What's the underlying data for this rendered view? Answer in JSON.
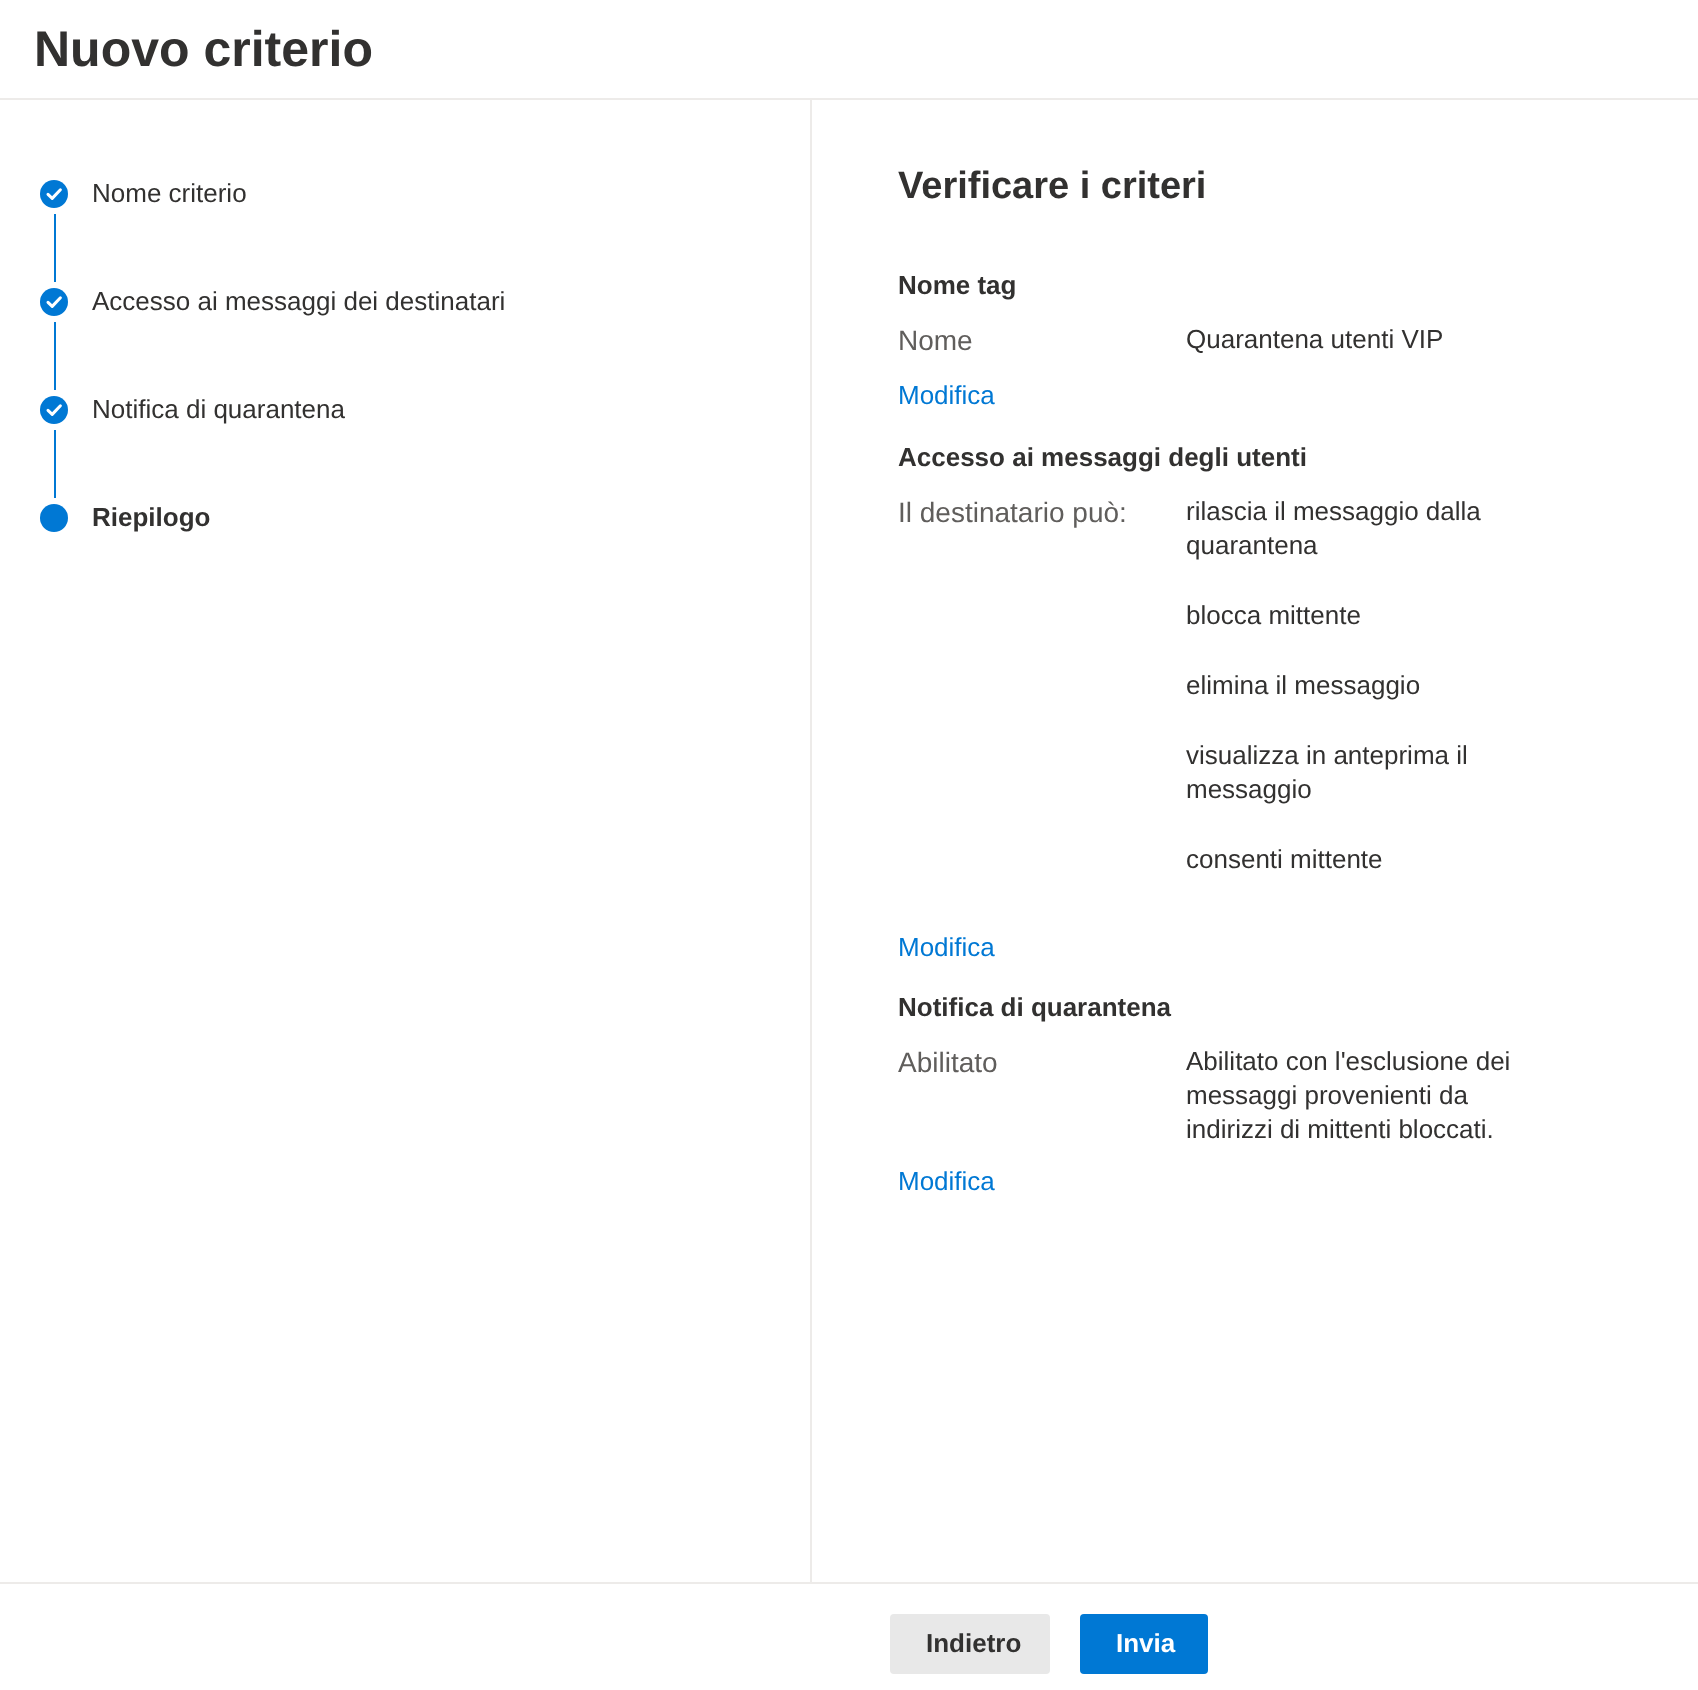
{
  "title": "Nuovo criterio",
  "steps": [
    {
      "label": "Nome criterio",
      "completed": true,
      "selected": false
    },
    {
      "label": "Accesso ai messaggi dei destinatari",
      "completed": true,
      "selected": false
    },
    {
      "label": "Notifica di quarantena",
      "completed": true,
      "selected": false
    },
    {
      "label": "Riepilogo",
      "completed": false,
      "selected": true
    }
  ],
  "review": {
    "title": "Verificare i criteri",
    "sections": [
      {
        "heading": "Nome tag",
        "rows": [
          {
            "label": "Nome",
            "values": [
              "Quarantena utenti VIP"
            ]
          }
        ],
        "link": "Modifica"
      },
      {
        "heading": "Accesso ai messaggi degli utenti",
        "rows": [
          {
            "label": "Il destinatario può:",
            "values": [
              "rilascia il messaggio dalla quarantena",
              "blocca mittente",
              "elimina il messaggio",
              "visualizza in anteprima il messaggio",
              "consenti mittente"
            ]
          }
        ],
        "link": "Modifica"
      },
      {
        "heading": "Notifica di quarantena",
        "rows": [
          {
            "label": "Abilitato",
            "values": [
              "Abilitato con l'esclusione dei messaggi provenienti da indirizzi di mittenti bloccati."
            ]
          }
        ],
        "link": "Modifica"
      }
    ]
  },
  "footer": {
    "buttons": [
      {
        "label": "Indietro",
        "kind": "secondary"
      },
      {
        "label": "Invia",
        "kind": "primary"
      }
    ]
  }
}
